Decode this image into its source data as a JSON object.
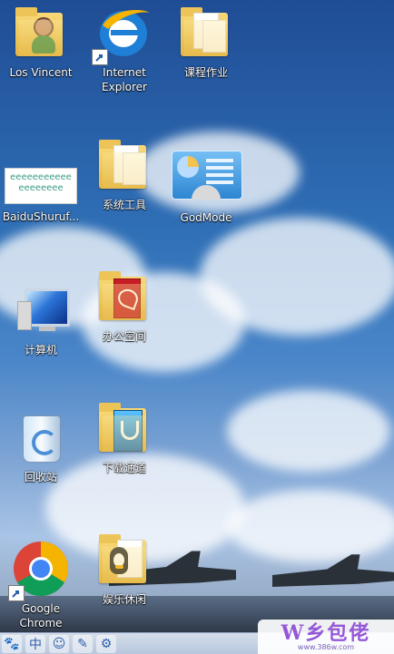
{
  "desktop": {
    "icons": [
      {
        "label": "Los Vincent"
      },
      {
        "label": "Internet\nExplorer"
      },
      {
        "label": "课程作业"
      },
      {
        "label": "BaiduShuruf..."
      },
      {
        "label": "系统工具"
      },
      {
        "label": "GodMode"
      },
      {
        "label": "计算机"
      },
      {
        "label": "办公空间"
      },
      {
        "label": "回收站"
      },
      {
        "label": "下载通道"
      },
      {
        "label": "Google\nChrome"
      },
      {
        "label": "娱乐休闲"
      }
    ],
    "baidu_preview_text": "eeeeeeeeeee\neeeeeeee"
  },
  "taskbar": {
    "buttons": [
      {
        "icon": "paw-icon"
      },
      {
        "label": "中"
      },
      {
        "icon": "smile-icon"
      },
      {
        "icon": "pen-icon"
      },
      {
        "icon": "gear-icon"
      }
    ]
  },
  "watermark": {
    "text": "W乡包佬",
    "subtext": "www.386w.com"
  },
  "colors": {
    "folder": "#f1c654",
    "label_text": "#ffffff",
    "ie_blue": "#1f7fd6",
    "chrome_red": "#db4437",
    "chrome_yellow": "#f4b400",
    "chrome_green": "#0f9d58"
  }
}
